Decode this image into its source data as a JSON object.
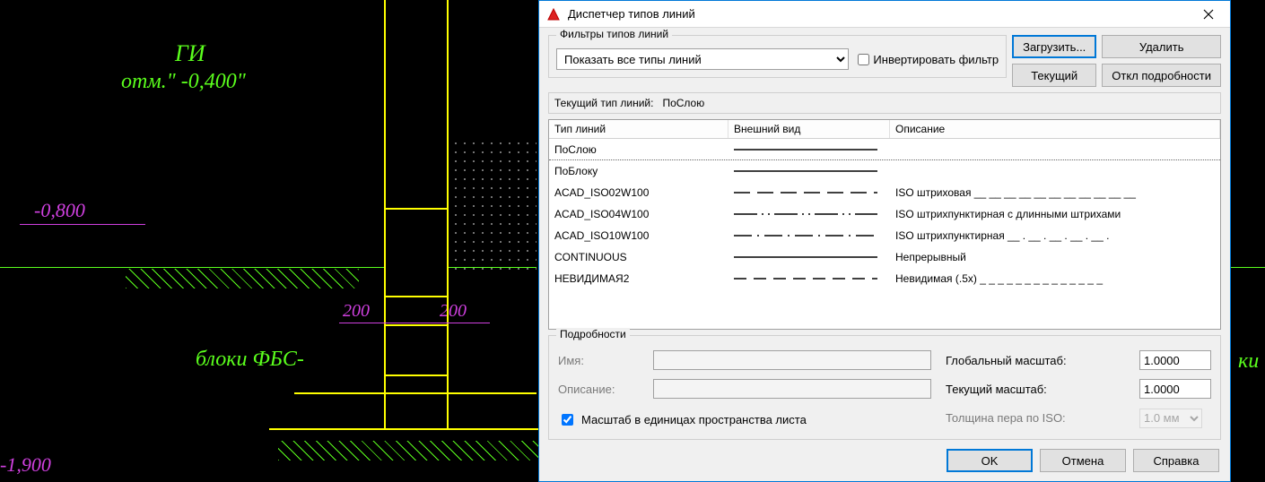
{
  "cad": {
    "label_gi": "ГИ",
    "label_otm": "отм.\" -0,400\"",
    "label_m0800": "-0,800",
    "label_200_l": "200",
    "label_200_r": "200",
    "label_blocks": "блоки ФБС-",
    "label_m1900": "-1,900",
    "label_ki": "ки"
  },
  "dialog": {
    "title": "Диспетчер типов линий",
    "filters": {
      "group_label": "Фильтры типов линий",
      "combo_value": "Показать все типы линий",
      "invert_label": "Инвертировать фильтр",
      "invert_checked": false
    },
    "buttons": {
      "load": "Загрузить...",
      "delete": "Удалить",
      "current": "Текущий",
      "details_off": "Откл подробности"
    },
    "current_prefix": "Текущий тип линий:",
    "current_value": "ПоСлою",
    "columns": {
      "name": "Тип линий",
      "appearance": "Внешний вид",
      "description": "Описание"
    },
    "rows": [
      {
        "name": "ПоСлою",
        "pattern": "solid",
        "desc": ""
      },
      {
        "name": "ПоБлоку",
        "pattern": "solid",
        "desc": ""
      },
      {
        "name": "ACAD_ISO02W100",
        "pattern": "dash",
        "desc": "ISO штриховая __ __ __ __ __ __ __ __ __ __ __"
      },
      {
        "name": "ACAD_ISO04W100",
        "pattern": "dashdot2",
        "desc": "ISO штрихпунктирная с длинными штрихами"
      },
      {
        "name": "ACAD_ISO10W100",
        "pattern": "dashdot",
        "desc": "ISO штрихпунктирная __ . __ . __ . __ . __ ."
      },
      {
        "name": "CONTINUOUS",
        "pattern": "solid",
        "desc": "Непрерывный"
      },
      {
        "name": "НЕВИДИМАЯ2",
        "pattern": "dash2",
        "desc": "Невидимая (.5x) _ _ _ _ _ _ _ _ _ _ _ _ _ _"
      }
    ],
    "selected_row": 0,
    "details": {
      "group_label": "Подробности",
      "name_label": "Имя:",
      "desc_label": "Описание:",
      "units_label": "Масштаб в единицах пространства листа",
      "units_checked": true,
      "global_scale_label": "Глобальный масштаб:",
      "global_scale_value": "1.0000",
      "current_scale_label": "Текущий масштаб:",
      "current_scale_value": "1.0000",
      "iso_pen_label": "Толщина пера по ISO:",
      "iso_pen_value": "1.0 мм"
    },
    "footer": {
      "ok": "OK",
      "cancel": "Отмена",
      "help": "Справка"
    }
  }
}
